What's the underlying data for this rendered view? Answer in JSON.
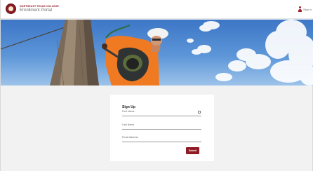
{
  "header": {
    "college_name": "NORTHEAST TEXAS COLLEGE",
    "portal_name": "Enrollment Portal",
    "signin_label": "Sign In"
  },
  "signup": {
    "title": "Sign Up",
    "first_name_placeholder": "First Name",
    "last_name_placeholder": "Last Name",
    "email_placeholder": "Email Address",
    "submit_label": "Submit"
  },
  "icons": {
    "logo": "college-seal-icon",
    "user": "user-icon",
    "autofill": "key-icon"
  },
  "colors": {
    "brand": "#8f1b24",
    "sky": "#3c76c6"
  }
}
